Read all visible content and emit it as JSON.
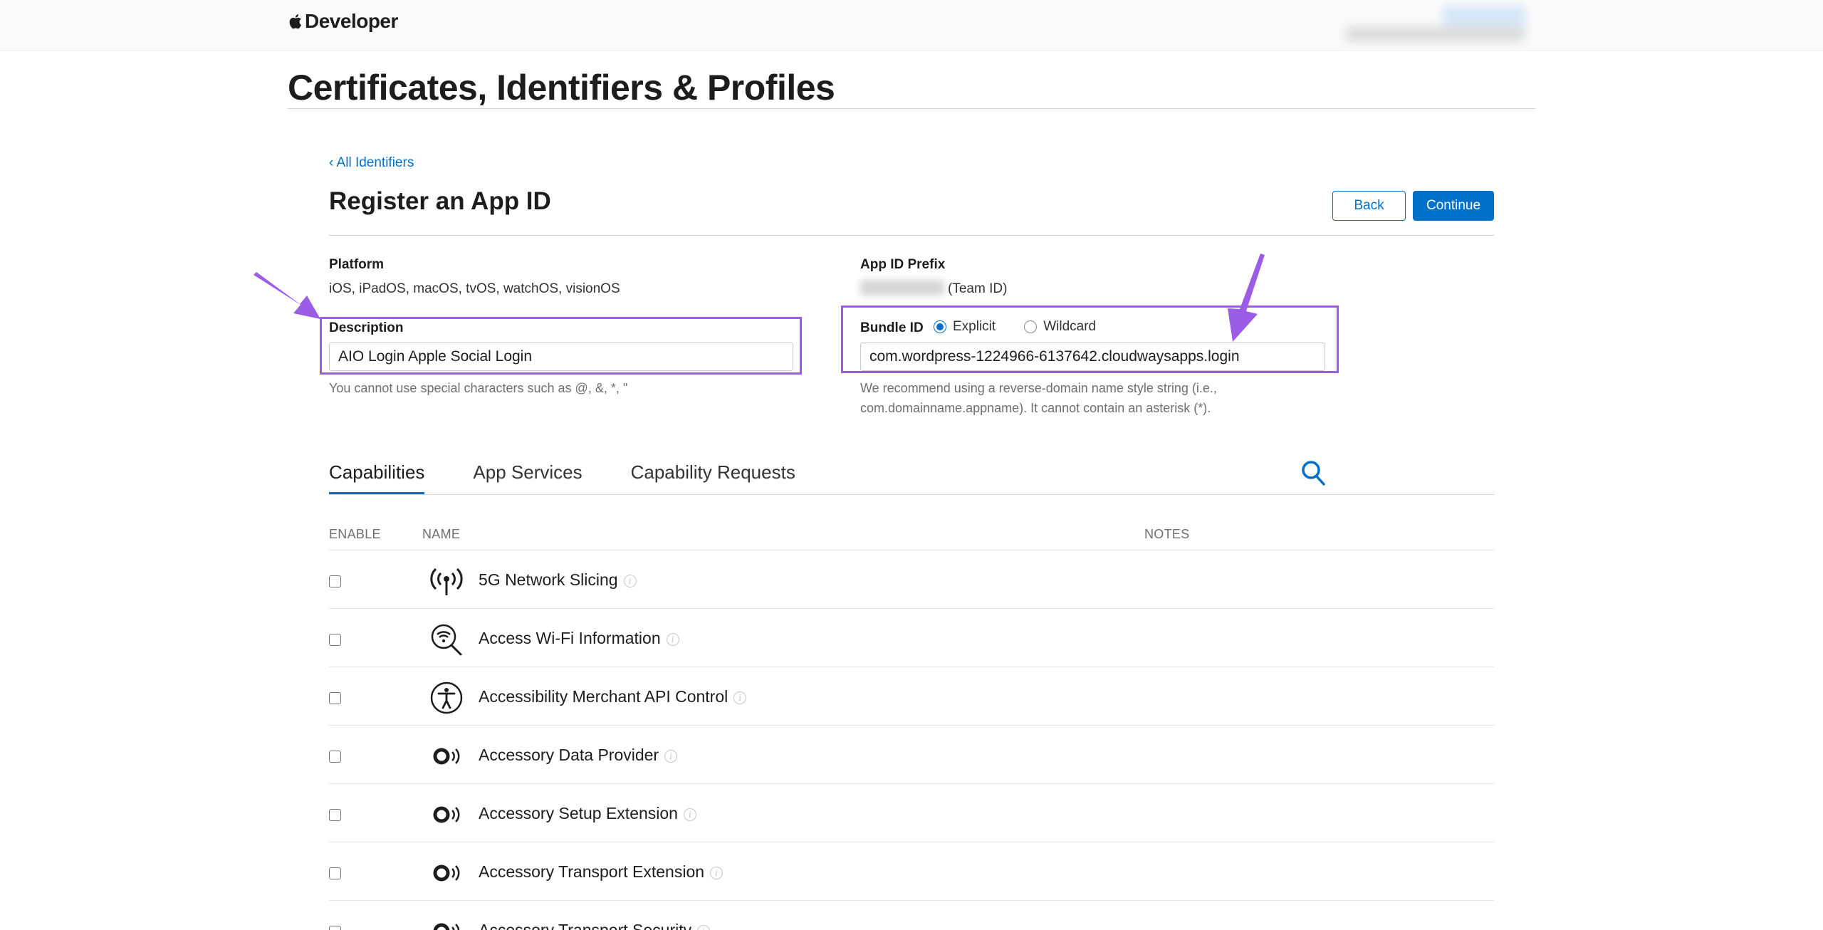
{
  "header": {
    "brand": "Developer",
    "page_title": "Certificates, Identifiers & Profiles"
  },
  "nav": {
    "back_link": "‹ All Identifiers"
  },
  "form": {
    "title": "Register an App ID",
    "back_label": "Back",
    "continue_label": "Continue",
    "platform_label": "Platform",
    "platform_value": "iOS, iPadOS, macOS, tvOS, watchOS, visionOS",
    "description_label": "Description",
    "description_value": "AIO Login Apple Social Login",
    "description_hint": "You cannot use special characters such as @, &, *, \"",
    "prefix_label": "App ID Prefix",
    "prefix_suffix": "(Team ID)",
    "bundle_label": "Bundle ID",
    "bundle_options": [
      "Explicit",
      "Wildcard"
    ],
    "bundle_selected": "Explicit",
    "bundle_value": "com.wordpress-1224966-6137642.cloudwaysapps.login",
    "bundle_hint_1": "We recommend using a reverse-domain name style string (i.e.,",
    "bundle_hint_2": "com.domainname.appname). It cannot contain an asterisk (*)."
  },
  "tabs": [
    "Capabilities",
    "App Services",
    "Capability Requests"
  ],
  "active_tab": "Capabilities",
  "table": {
    "columns": [
      "ENABLE",
      "NAME",
      "NOTES"
    ],
    "rows": [
      {
        "name": "5G Network Slicing",
        "icon": "antenna-icon"
      },
      {
        "name": "Access Wi-Fi Information",
        "icon": "wifi-search-icon"
      },
      {
        "name": "Accessibility Merchant API Control",
        "icon": "accessibility-icon"
      },
      {
        "name": "Accessory Data Provider",
        "icon": "accessory-icon"
      },
      {
        "name": "Accessory Setup Extension",
        "icon": "accessory-icon"
      },
      {
        "name": "Accessory Transport Extension",
        "icon": "accessory-icon"
      },
      {
        "name": "Accessory Transport Security",
        "icon": "accessory-icon"
      }
    ]
  },
  "colors": {
    "accent": "#0070c9",
    "highlight": "#9b5de5"
  }
}
